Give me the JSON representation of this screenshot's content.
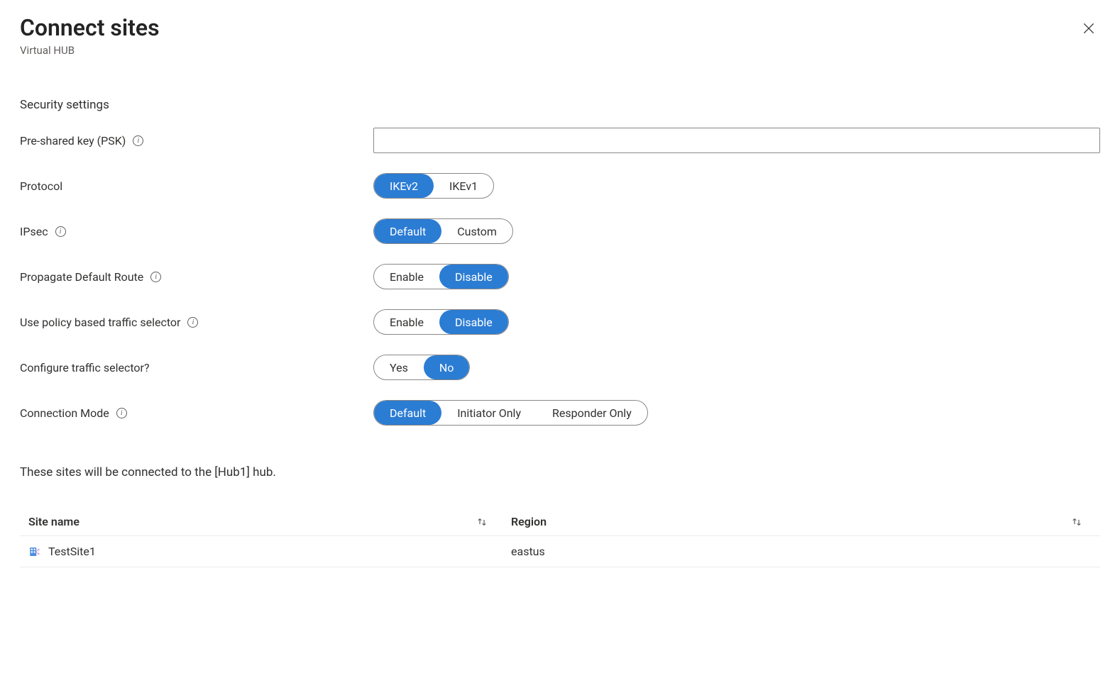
{
  "header": {
    "title": "Connect sites",
    "subtitle": "Virtual HUB"
  },
  "section": {
    "title": "Security settings"
  },
  "labels": {
    "psk": "Pre-shared key (PSK)",
    "protocol": "Protocol",
    "ipsec": "IPsec",
    "propagate": "Propagate Default Route",
    "policy": "Use policy based traffic selector",
    "configure": "Configure traffic selector?",
    "connmode": "Connection Mode"
  },
  "options": {
    "protocol": {
      "a": "IKEv2",
      "b": "IKEv1"
    },
    "ipsec": {
      "a": "Default",
      "b": "Custom"
    },
    "propagate": {
      "a": "Enable",
      "b": "Disable"
    },
    "policy": {
      "a": "Enable",
      "b": "Disable"
    },
    "configure": {
      "a": "Yes",
      "b": "No"
    },
    "connmode": {
      "a": "Default",
      "b": "Initiator Only",
      "c": "Responder Only"
    }
  },
  "connect_text": "These sites will be connected to the [Hub1] hub.",
  "table": {
    "headers": {
      "site": "Site name",
      "region": "Region"
    },
    "rows": [
      {
        "site": "TestSite1",
        "region": "eastus"
      }
    ]
  }
}
